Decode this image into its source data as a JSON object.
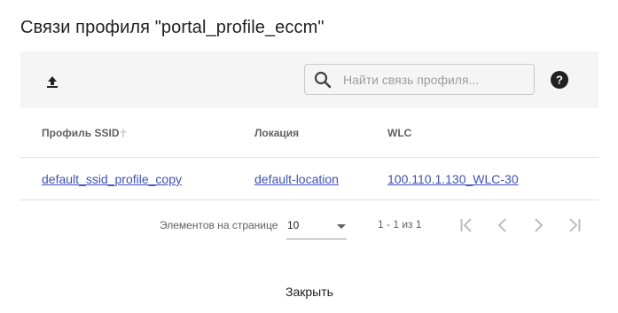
{
  "dialog": {
    "title": "Связи профиля \"portal_profile_eccm\""
  },
  "toolbar": {
    "upload_icon": "upload-icon",
    "search": {
      "placeholder": "Найти связь профиля...",
      "value": ""
    },
    "help_icon": "help-circle-icon"
  },
  "table": {
    "columns": [
      "Профиль SSID",
      "Локация",
      "WLC"
    ],
    "rows": [
      [
        "default_ssid_profile_copy",
        "default-location",
        "100.110.1.130_WLC-30"
      ]
    ]
  },
  "paginator": {
    "items_per_page_label": "Элементов на странице",
    "page_size": "10",
    "range": "1 - 1 из 1"
  },
  "actions": {
    "close_label": "Закрыть"
  },
  "colors": {
    "link": "#3f51b5",
    "toolbar_bg": "#f5f5f5",
    "text": "#212121",
    "muted": "#616161",
    "disabled_icon": "#bdbdbd"
  }
}
